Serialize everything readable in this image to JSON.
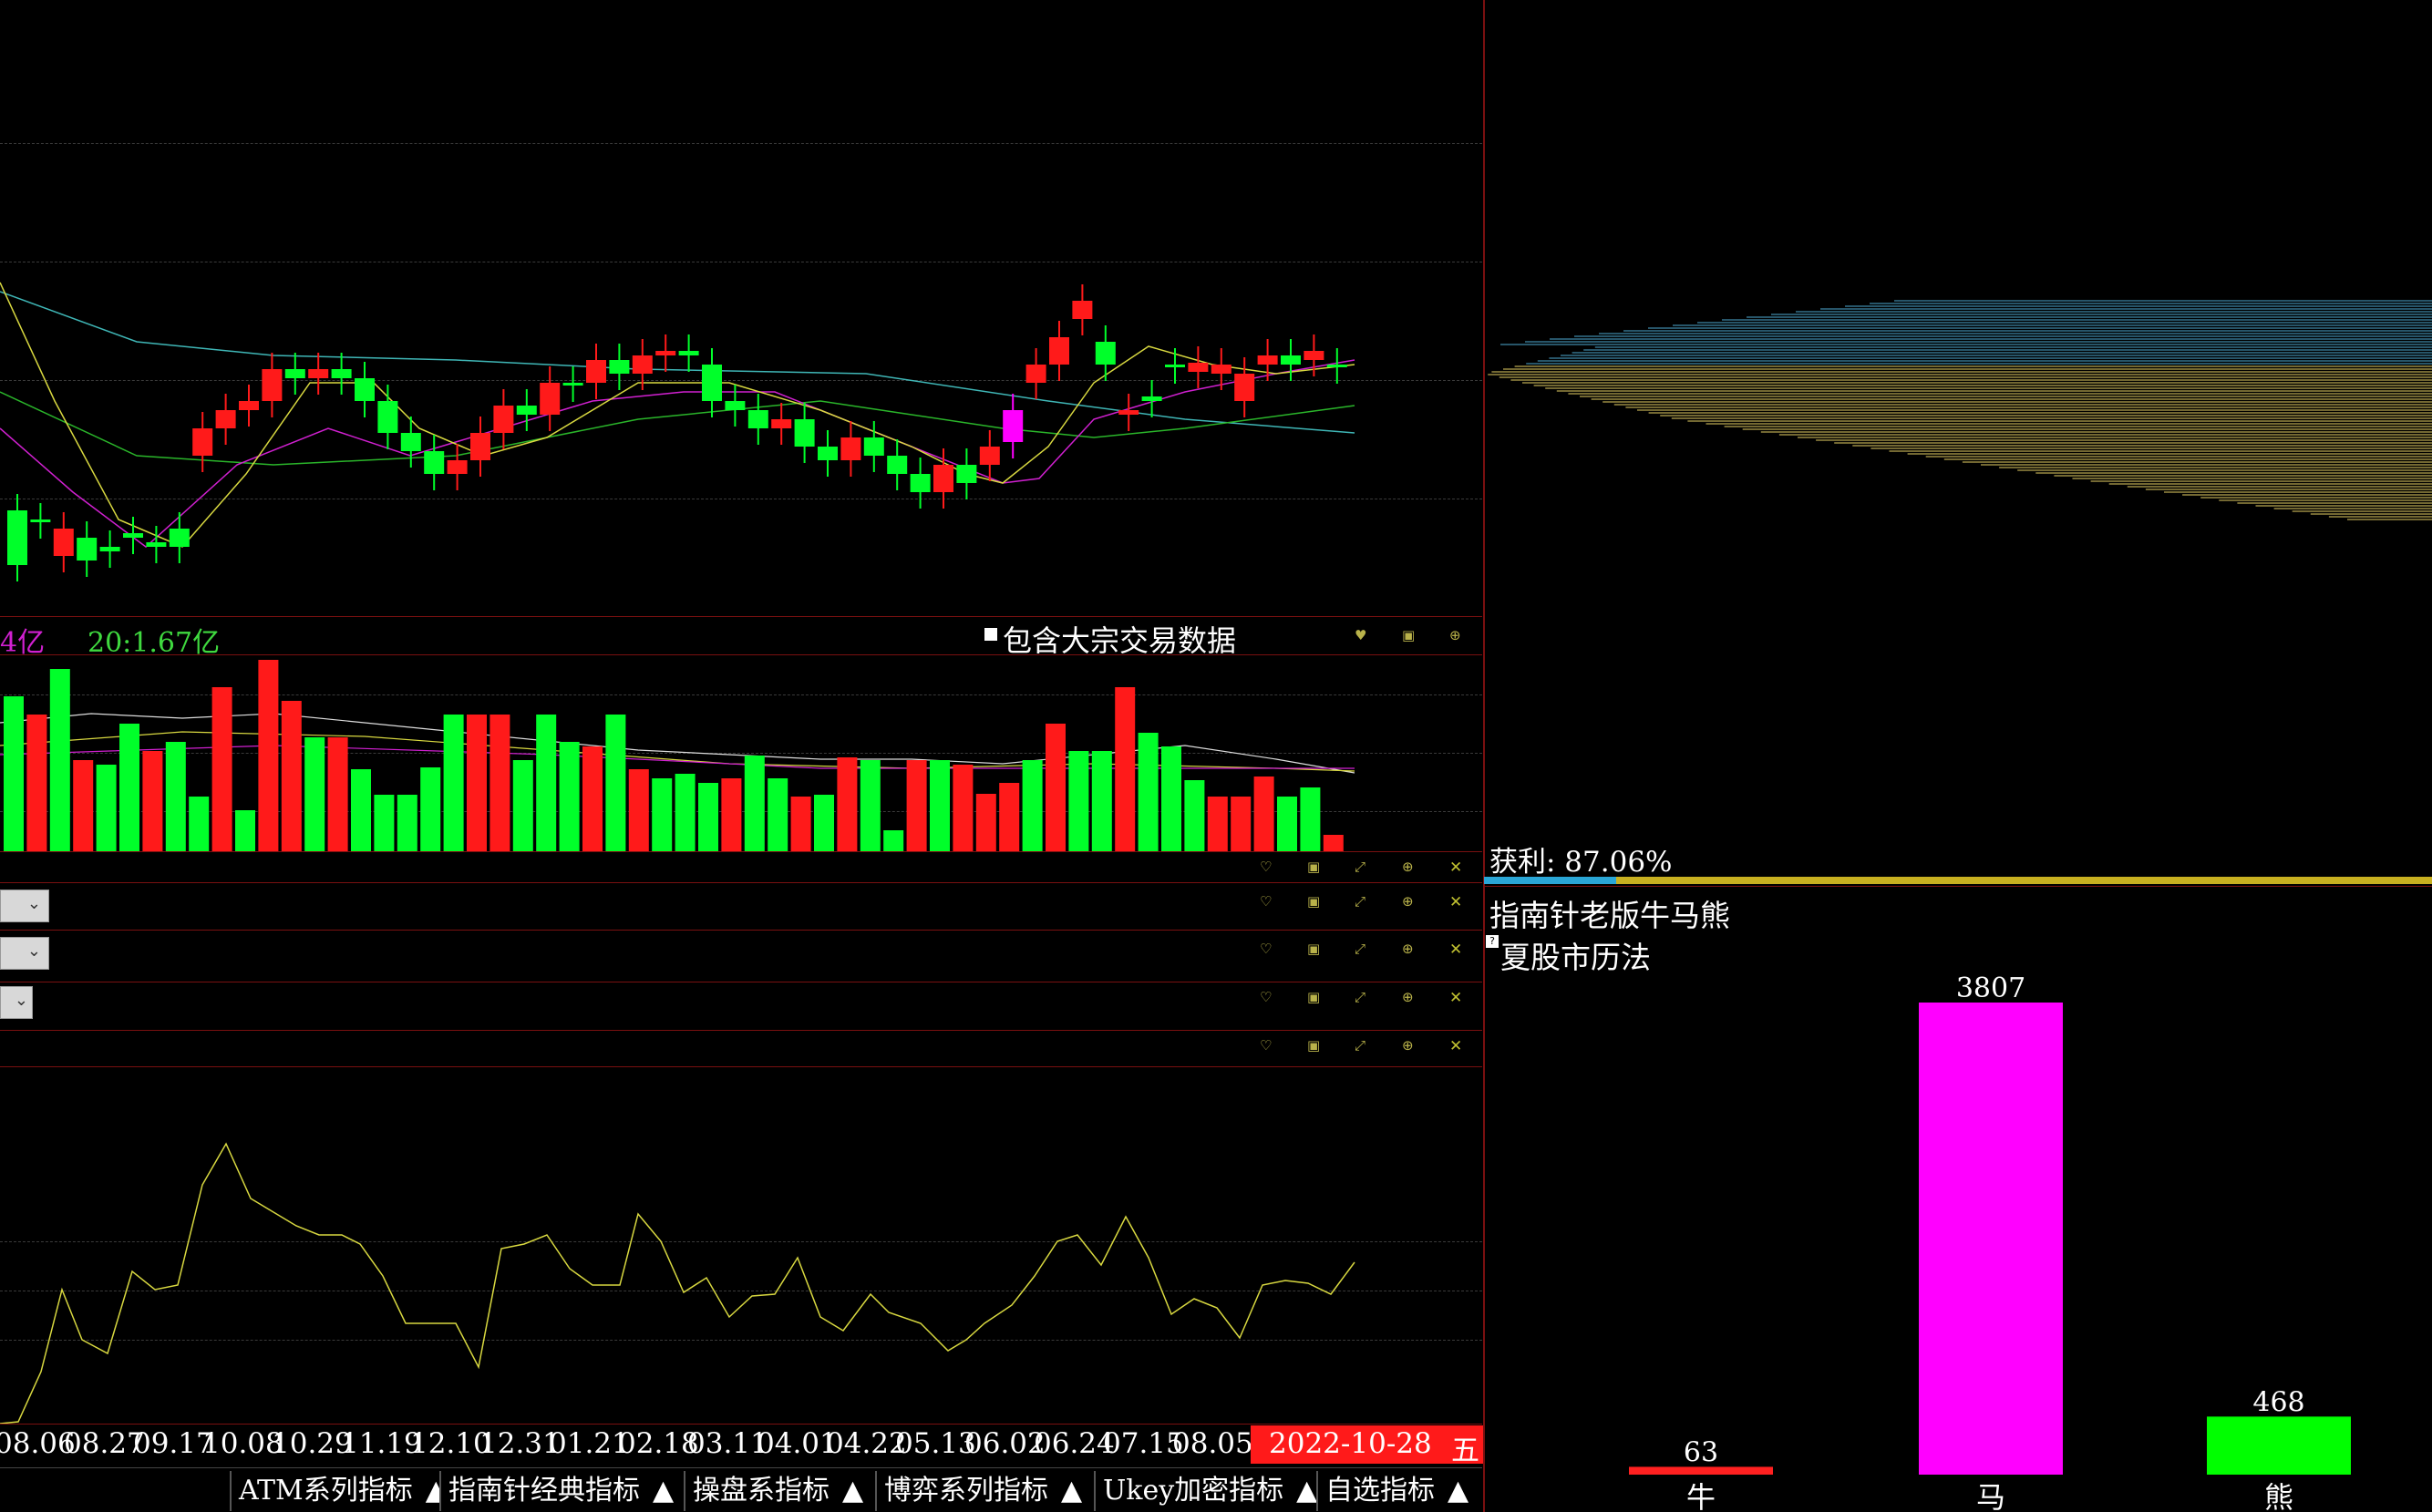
{
  "main_chart": {
    "volume_label_left": "4亿",
    "volume_label_ma": "20:1.67亿",
    "include_block_trade_label": "包含大宗交易数据"
  },
  "date_axis": {
    "labels": [
      "08.06",
      "08.27",
      "09.17",
      "10.08",
      "10.29",
      "11.19",
      "12.10",
      "12.31",
      "01.21",
      "02.18",
      "03.11",
      "04.01",
      "04.22",
      "05.13",
      "06.02",
      "06.24",
      "07.15",
      "08.05"
    ],
    "current_date": "2022-10-28",
    "weekday": "五"
  },
  "bottom_toolbar": [
    {
      "label": "ATM系列指标",
      "arrow": "▲"
    },
    {
      "label": "指南针经典指标",
      "arrow": "▲"
    },
    {
      "label": "操盘系指标",
      "arrow": "▲"
    },
    {
      "label": "博弈系列指标",
      "arrow": "▲"
    },
    {
      "label": "Ukey加密指标",
      "arrow": "▲"
    },
    {
      "label": "自选指标",
      "arrow": "▲"
    }
  ],
  "chip_panel": {
    "profit_label": "获利: 87.06%",
    "profit_ratio": 0.8706
  },
  "bull_bear_panel": {
    "title": "指南针老版牛马熊",
    "subtitle": "夏股市历法",
    "chart_data": {
      "type": "bar",
      "categories": [
        "牛",
        "马",
        "熊"
      ],
      "values": [
        63,
        3807,
        468
      ],
      "colors": [
        "#ff2020",
        "#ff00ff",
        "#00ff00"
      ],
      "ylim": [
        0,
        3807
      ]
    }
  },
  "colors": {
    "up": "#ff1a1a",
    "down": "#00ff2a",
    "border": "#7a1010",
    "date_highlight": "#ff1a1a"
  },
  "icons": [
    "heart-icon",
    "window-icon",
    "expand-icon",
    "zoom-icon",
    "close-icon",
    "dropdown-chevron-icon"
  ]
}
